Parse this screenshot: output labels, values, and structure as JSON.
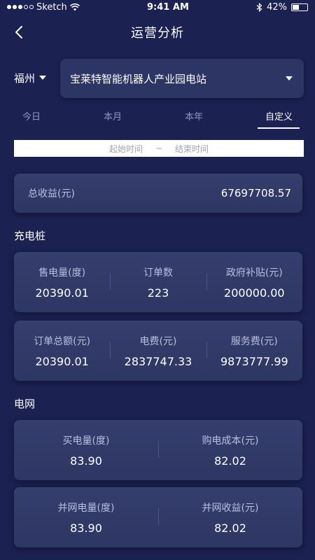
{
  "status_bar": {
    "carrier": "Sketch",
    "time": "9:41 AM",
    "battery": "42%"
  },
  "nav": {
    "title": "运营分析",
    "back_icon": "chevron-left-icon"
  },
  "filters": {
    "city": "福州",
    "station": "宝莱特智能机器人产业园电站"
  },
  "tabs": [
    {
      "label": "今日",
      "active": false
    },
    {
      "label": "本月",
      "active": false
    },
    {
      "label": "本年",
      "active": false
    },
    {
      "label": "自定义",
      "active": true
    }
  ],
  "date_range": {
    "start_placeholder": "起始时间",
    "separator": "~",
    "end_placeholder": "结束时间"
  },
  "total": {
    "label": "总收益(元)",
    "value": "67697708.57"
  },
  "charging": {
    "title": "充电桩",
    "row1": [
      {
        "label": "售电量(度)",
        "value": "20390.01"
      },
      {
        "label": "订单数",
        "value": "223"
      },
      {
        "label": "政府补贴(元)",
        "value": "200000.00"
      }
    ],
    "row2": [
      {
        "label": "订单总额(元)",
        "value": "20390.01"
      },
      {
        "label": "电费(元)",
        "value": "2837747.33"
      },
      {
        "label": "服务费(元)",
        "value": "9873777.99"
      }
    ]
  },
  "grid": {
    "title": "电网",
    "row1": [
      {
        "label": "买电量(度)",
        "value": "83.90"
      },
      {
        "label": "购电成本(元)",
        "value": "82.02"
      }
    ],
    "row2": [
      {
        "label": "并网电量(度)",
        "value": "83.90"
      },
      {
        "label": "并网收益(元)",
        "value": "82.02"
      }
    ]
  },
  "colors": {
    "background": "#1b2150",
    "card": "#323b68",
    "label": "#b9bfe0",
    "value": "#ffffff",
    "tab_inactive": "#8f97bf"
  }
}
